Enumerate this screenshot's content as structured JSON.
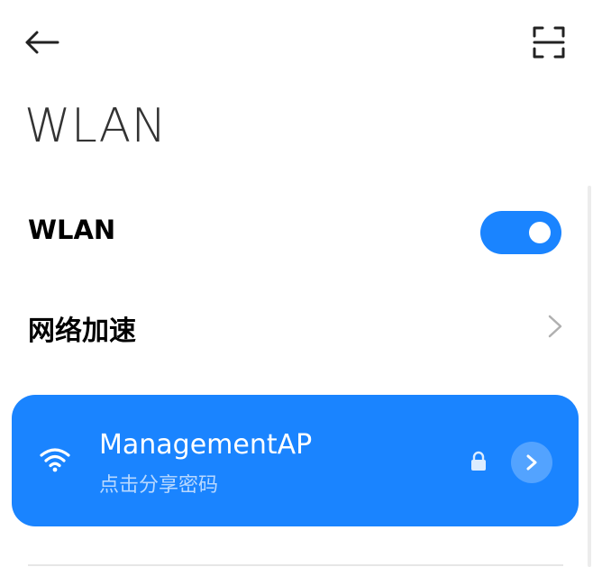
{
  "header": {
    "back_icon": "arrow-left-icon",
    "scan_icon": "scan-qr-icon",
    "title": "WLAN"
  },
  "settings": {
    "wlan": {
      "label": "WLAN",
      "toggle_on": true,
      "accent_color": "#1a84ff"
    },
    "network_acceleration": {
      "label": "网络加速",
      "chevron_icon": "chevron-right-icon"
    }
  },
  "connected_network": {
    "ssid": "ManagementAP",
    "subtitle": "点击分享密码",
    "wifi_icon": "wifi-signal-icon",
    "lock_icon": "lock-icon",
    "detail_icon": "chevron-right-icon",
    "card_color": "#1a84ff"
  }
}
